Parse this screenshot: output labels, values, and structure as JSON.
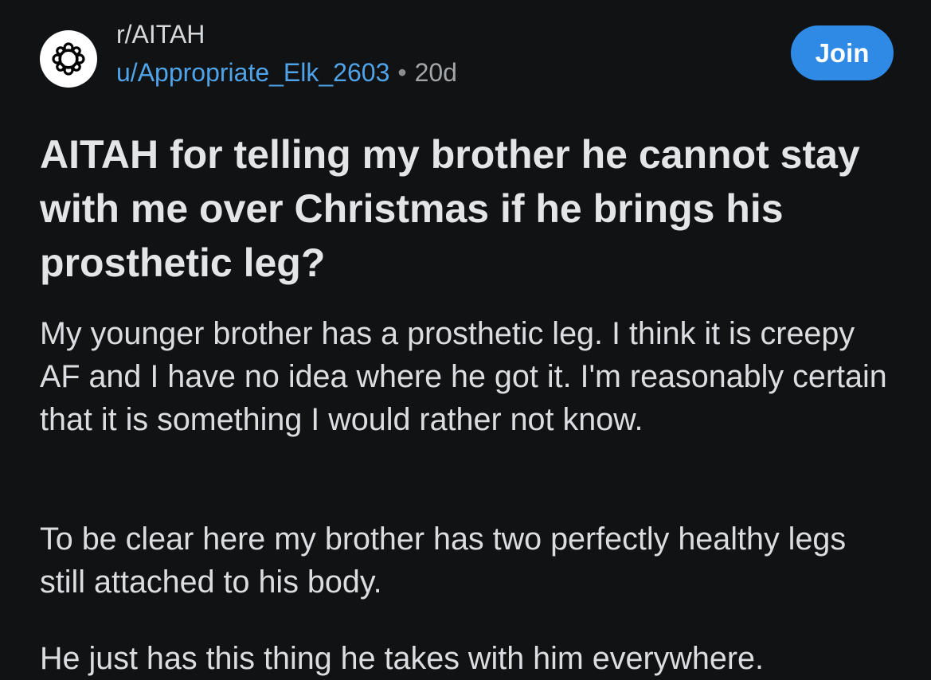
{
  "header": {
    "subreddit": "r/AITAH",
    "username": "u/Appropriate_Elk_2603",
    "separator": "•",
    "age": "20d",
    "join_label": "Join",
    "avatar_icon": "subreddit-avatar-icon"
  },
  "post": {
    "title": "AITAH for telling my brother he cannot stay with me over Christmas if he brings his prosthetic leg?",
    "paragraphs": [
      "My younger brother has a prosthetic leg. I think it is creepy AF and I have no idea where he got it. I'm reasonably certain that it is something I would rather not know.",
      "To be clear here my brother has two perfectly healthy legs still attached to his body.",
      "He just has this thing he takes with him everywhere."
    ]
  },
  "colors": {
    "background": "#111213",
    "accent": "#2f8ae6",
    "username": "#4fa3e8",
    "text": "#e4e5e7"
  }
}
